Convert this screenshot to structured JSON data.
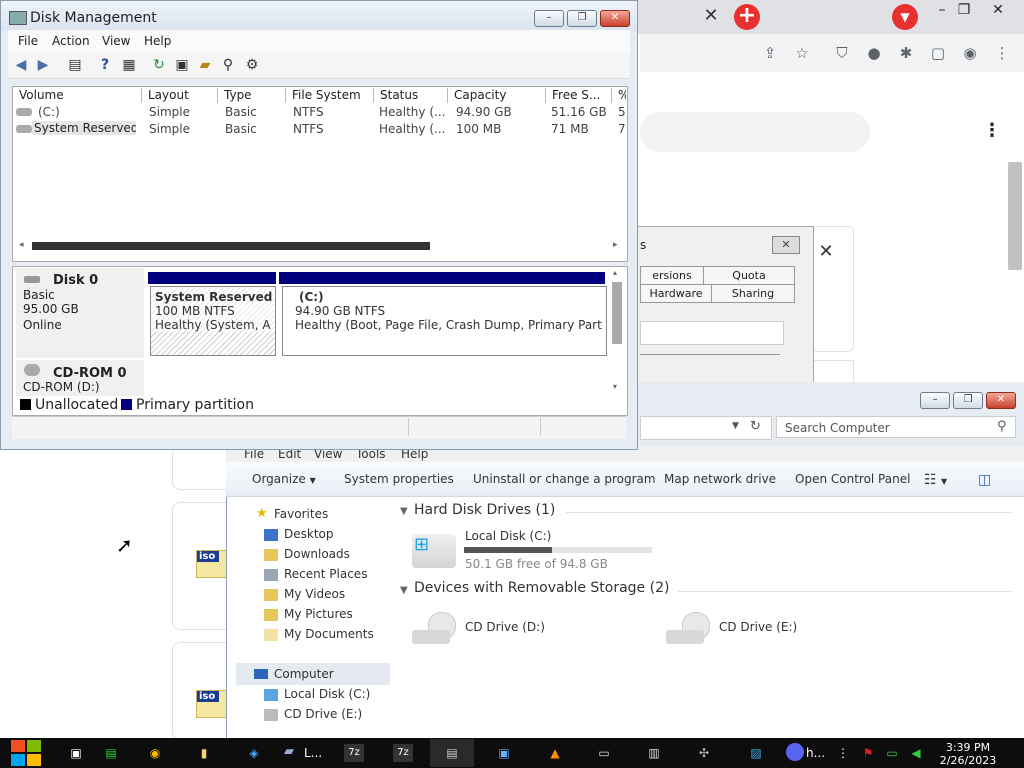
{
  "disk_mgmt": {
    "title": "Disk Management",
    "menus": [
      "File",
      "Action",
      "View",
      "Help"
    ],
    "toolbar_icons": [
      "back-icon",
      "forward-icon",
      "console-tree-icon",
      "help-icon",
      "properties-icon",
      "refresh-icon",
      "properties-sheet-icon",
      "open-folder-icon",
      "search-icon",
      "settings-icon"
    ],
    "columns": [
      "Volume",
      "Layout",
      "Type",
      "File System",
      "Status",
      "Capacity",
      "Free S...",
      "%"
    ],
    "volumes": [
      {
        "volume": "(C:)",
        "layout": "Simple",
        "type": "Basic",
        "fs": "NTFS",
        "status": "Healthy (...",
        "capacity": "94.90 GB",
        "free": "51.16 GB",
        "pct": "5"
      },
      {
        "volume": "System Reserved",
        "layout": "Simple",
        "type": "Basic",
        "fs": "NTFS",
        "status": "Healthy (...",
        "capacity": "100 MB",
        "free": "71 MB",
        "pct": "7"
      }
    ],
    "disk0": {
      "name": "Disk 0",
      "type": "Basic",
      "size": "95.00 GB",
      "state": "Online"
    },
    "partitions": [
      {
        "name": "System Reserved",
        "detail": "100 MB NTFS",
        "status": "Healthy (System, Act"
      },
      {
        "name": "(C:)",
        "detail": "94.90 GB NTFS",
        "status": "Healthy (Boot, Page File, Crash Dump, Primary Partition)"
      }
    ],
    "cdrom": {
      "name": "CD-ROM 0",
      "detail": "CD-ROM (D:)"
    },
    "legend": {
      "unallocated": "Unallocated",
      "primary": "Primary partition"
    }
  },
  "props_dialog": {
    "title_partial": "s",
    "tabs": [
      "ersions",
      "Quota",
      "Hardware",
      "Sharing"
    ]
  },
  "explorer": {
    "search_placeholder": "Search Computer",
    "menus": [
      "File",
      "Edit",
      "View",
      "Tools",
      "Help"
    ],
    "commands": [
      "Organize",
      "System properties",
      "Uninstall or change a program",
      "Map network drive",
      "Open Control Panel"
    ],
    "favorites_header": "Favorites",
    "favorites": [
      "Desktop",
      "Downloads",
      "Recent Places",
      "My Videos",
      "My Pictures",
      "My Documents"
    ],
    "computer": "Computer",
    "computer_items": [
      "Local Disk (C:)",
      "CD Drive (E:)"
    ],
    "hdd_group": "Hard Disk Drives (1)",
    "local_disk": {
      "name": "Local Disk (C:)",
      "free": "50.1 GB free of 94.8 GB",
      "used_fraction": 0.47
    },
    "removable_group": "Devices with Removable Storage (2)",
    "cd_drives": [
      "CD Drive (D:)",
      "CD Drive (E:)"
    ]
  },
  "taskbar": {
    "time": "3:39 PM",
    "date": "2/26/2023",
    "apps": [
      "L...",
      "h..."
    ]
  },
  "desktop": {
    "iso_label": "iso"
  },
  "colors": {
    "primary_partition": "#00007f",
    "chrome_red": "#e8312f",
    "taskbar": "#0d0d0d"
  }
}
